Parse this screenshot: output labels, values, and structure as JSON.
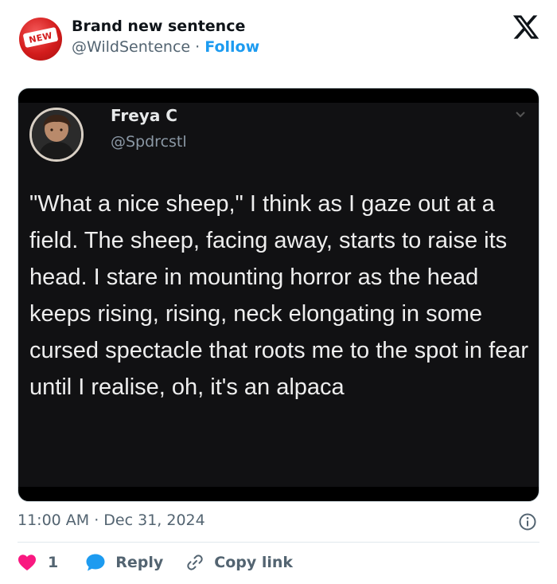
{
  "header": {
    "author_name": "Brand new sentence",
    "author_handle": "@WildSentence",
    "separator": "·",
    "follow_label": "Follow",
    "avatar_badge_text": "NEW",
    "platform_icon": "x-logo-icon"
  },
  "embedded_post": {
    "name": "Freya C",
    "handle": "@Spdrcstl",
    "text": "\"What a nice sheep,\" I think as I gaze out at a field. The sheep, facing away, starts to raise its head. I stare in mounting horror as the head keeps rising, rising, neck elongating in some cursed spectacle that roots me to the spot in fear until I realise, oh, it's an alpaca"
  },
  "meta": {
    "timestamp": "11:00 AM · Dec 31, 2024",
    "info_icon": "info-icon"
  },
  "actions": {
    "like_count": "1",
    "reply_label": "Reply",
    "copy_link_label": "Copy link"
  },
  "colors": {
    "accent": "#1d9bf0",
    "like": "#f91880",
    "badge": "#d31c1c"
  }
}
